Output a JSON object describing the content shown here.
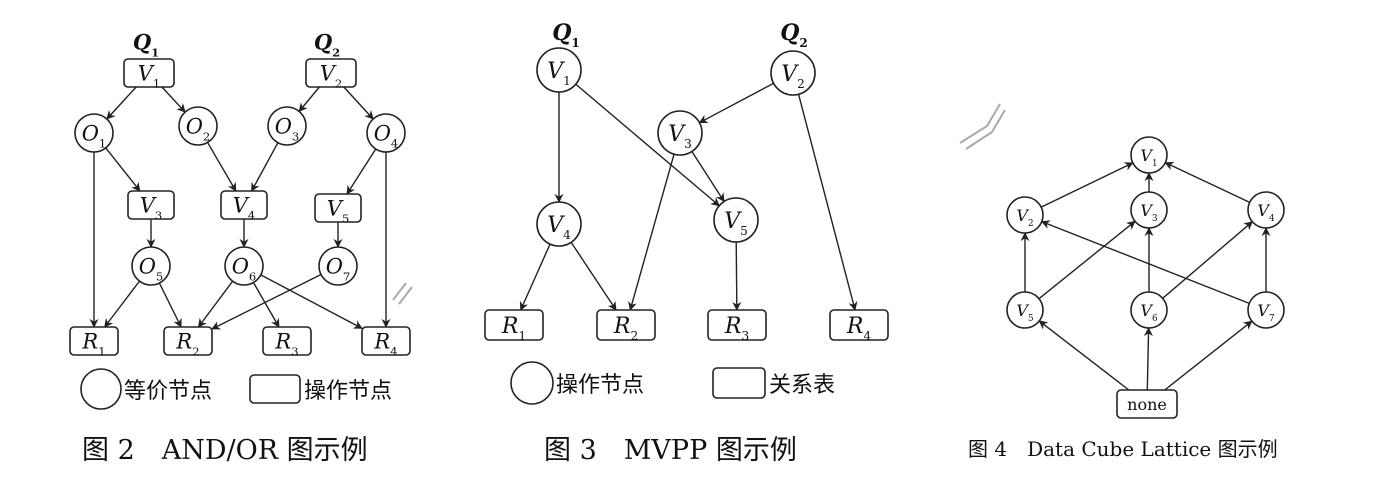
{
  "figure2": {
    "queries": [
      {
        "id": "Q1",
        "base": "Q",
        "sub": "1"
      },
      {
        "id": "Q2",
        "base": "Q",
        "sub": "2"
      }
    ],
    "nodes": [
      {
        "id": "V1",
        "shape": "rect",
        "base": "V",
        "sub": "1"
      },
      {
        "id": "V2",
        "shape": "rect",
        "base": "V",
        "sub": "2"
      },
      {
        "id": "O1",
        "shape": "circle",
        "base": "O",
        "sub": "1"
      },
      {
        "id": "O2",
        "shape": "circle",
        "base": "O",
        "sub": "2"
      },
      {
        "id": "O3",
        "shape": "circle",
        "base": "O",
        "sub": "3"
      },
      {
        "id": "O4",
        "shape": "circle",
        "base": "O",
        "sub": "4"
      },
      {
        "id": "V3",
        "shape": "rect",
        "base": "V",
        "sub": "3"
      },
      {
        "id": "V4",
        "shape": "rect",
        "base": "V",
        "sub": "4"
      },
      {
        "id": "V5",
        "shape": "rect",
        "base": "V",
        "sub": "5"
      },
      {
        "id": "O5",
        "shape": "circle",
        "base": "O",
        "sub": "5"
      },
      {
        "id": "O6",
        "shape": "circle",
        "base": "O",
        "sub": "6"
      },
      {
        "id": "O7",
        "shape": "circle",
        "base": "O",
        "sub": "7"
      },
      {
        "id": "R1",
        "shape": "rect",
        "base": "R",
        "sub": "1"
      },
      {
        "id": "R2",
        "shape": "rect",
        "base": "R",
        "sub": "2"
      },
      {
        "id": "R3",
        "shape": "rect",
        "base": "R",
        "sub": "3"
      },
      {
        "id": "R4",
        "shape": "rect",
        "base": "R",
        "sub": "4"
      }
    ],
    "edges": [
      [
        "V1",
        "O1"
      ],
      [
        "V1",
        "O2"
      ],
      [
        "V2",
        "O3"
      ],
      [
        "V2",
        "O4"
      ],
      [
        "O1",
        "V3"
      ],
      [
        "O1",
        "R1"
      ],
      [
        "O2",
        "V4"
      ],
      [
        "O3",
        "V4"
      ],
      [
        "O4",
        "V5"
      ],
      [
        "O4",
        "R4"
      ],
      [
        "V3",
        "O5"
      ],
      [
        "V4",
        "O6"
      ],
      [
        "V5",
        "O7"
      ],
      [
        "O5",
        "R1"
      ],
      [
        "O5",
        "R2"
      ],
      [
        "O6",
        "R2"
      ],
      [
        "O6",
        "R3"
      ],
      [
        "O6",
        "R4"
      ],
      [
        "O7",
        "R2"
      ]
    ],
    "legend": {
      "circle_label": "等价节点",
      "rect_label": "操作节点"
    },
    "caption": "图 2　AND/OR 图示例"
  },
  "figure3": {
    "queries": [
      {
        "id": "Q1",
        "base": "Q",
        "sub": "1"
      },
      {
        "id": "Q2",
        "base": "Q",
        "sub": "2"
      }
    ],
    "nodes": [
      {
        "id": "V1",
        "shape": "circle",
        "base": "V",
        "sub": "1"
      },
      {
        "id": "V2",
        "shape": "circle",
        "base": "V",
        "sub": "2"
      },
      {
        "id": "V3",
        "shape": "circle",
        "base": "V",
        "sub": "3"
      },
      {
        "id": "V4",
        "shape": "circle",
        "base": "V",
        "sub": "4"
      },
      {
        "id": "V5",
        "shape": "circle",
        "base": "V",
        "sub": "5"
      },
      {
        "id": "R1",
        "shape": "rect",
        "base": "R",
        "sub": "1"
      },
      {
        "id": "R2",
        "shape": "rect",
        "base": "R",
        "sub": "2"
      },
      {
        "id": "R3",
        "shape": "rect",
        "base": "R",
        "sub": "3"
      },
      {
        "id": "R4",
        "shape": "rect",
        "base": "R",
        "sub": "4"
      }
    ],
    "edges": [
      [
        "V1",
        "V4"
      ],
      [
        "V1",
        "V5"
      ],
      [
        "V2",
        "V3"
      ],
      [
        "V2",
        "R4"
      ],
      [
        "V3",
        "V5"
      ],
      [
        "V3",
        "R2"
      ],
      [
        "V4",
        "R1"
      ],
      [
        "V4",
        "R2"
      ],
      [
        "V5",
        "R3"
      ]
    ],
    "legend": {
      "circle_label": "操作节点",
      "rect_label": "关系表"
    },
    "caption": "图 3　MVPP 图示例"
  },
  "figure4": {
    "nodes": [
      {
        "id": "V1",
        "shape": "circle",
        "base": "V",
        "sub": "1"
      },
      {
        "id": "V2",
        "shape": "circle",
        "base": "V",
        "sub": "2"
      },
      {
        "id": "V3",
        "shape": "circle",
        "base": "V",
        "sub": "3"
      },
      {
        "id": "V4",
        "shape": "circle",
        "base": "V",
        "sub": "4"
      },
      {
        "id": "V5",
        "shape": "circle",
        "base": "V",
        "sub": "5"
      },
      {
        "id": "V6",
        "shape": "circle",
        "base": "V",
        "sub": "6"
      },
      {
        "id": "V7",
        "shape": "circle",
        "base": "V",
        "sub": "7"
      },
      {
        "id": "none",
        "shape": "rect",
        "base": "none",
        "sub": ""
      }
    ],
    "edges": [
      [
        "V2",
        "V1"
      ],
      [
        "V3",
        "V1"
      ],
      [
        "V4",
        "V1"
      ],
      [
        "V5",
        "V2"
      ],
      [
        "V5",
        "V3"
      ],
      [
        "V6",
        "V3"
      ],
      [
        "V6",
        "V4"
      ],
      [
        "V7",
        "V2"
      ],
      [
        "V7",
        "V4"
      ],
      [
        "none",
        "V5"
      ],
      [
        "none",
        "V6"
      ],
      [
        "none",
        "V7"
      ]
    ],
    "caption": "图 4　Data Cube Lattice 图示例"
  }
}
